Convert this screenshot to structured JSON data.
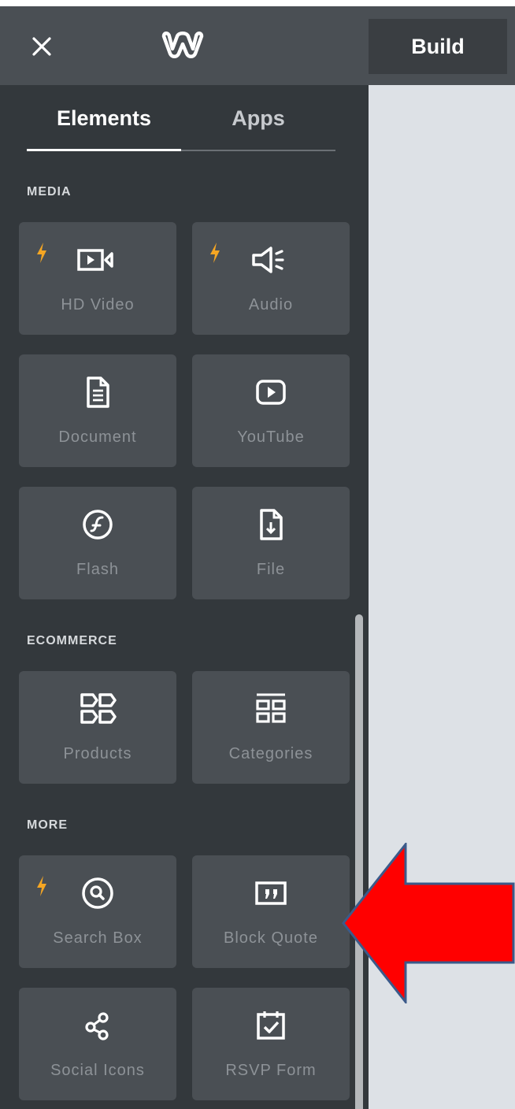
{
  "topbar": {
    "close_icon": "close-icon",
    "logo_icon": "weebly-logo-icon",
    "build_label": "Build"
  },
  "tabs": {
    "elements_label": "Elements",
    "apps_label": "Apps",
    "active": "Elements"
  },
  "sections": [
    {
      "title": "MEDIA",
      "tiles": [
        {
          "label": "HD Video",
          "icon": "video-camera-icon",
          "premium": true
        },
        {
          "label": "Audio",
          "icon": "speaker-icon",
          "premium": true
        },
        {
          "label": "Document",
          "icon": "document-icon",
          "premium": false
        },
        {
          "label": "YouTube",
          "icon": "youtube-play-icon",
          "premium": false
        },
        {
          "label": "Flash",
          "icon": "flash-icon",
          "premium": false
        },
        {
          "label": "File",
          "icon": "file-download-icon",
          "premium": false
        }
      ]
    },
    {
      "title": "ECOMMERCE",
      "tiles": [
        {
          "label": "Products",
          "icon": "products-icon",
          "premium": false
        },
        {
          "label": "Categories",
          "icon": "categories-icon",
          "premium": false
        }
      ]
    },
    {
      "title": "MORE",
      "tiles": [
        {
          "label": "Search Box",
          "icon": "search-icon",
          "premium": true
        },
        {
          "label": "Block Quote",
          "icon": "quote-icon",
          "premium": false
        },
        {
          "label": "Social Icons",
          "icon": "share-icon",
          "premium": false
        },
        {
          "label": "RSVP Form",
          "icon": "calendar-check-icon",
          "premium": false
        }
      ]
    }
  ],
  "colors": {
    "sidebar_bg": "#33383c",
    "tile_bg": "#4a4f54",
    "topbar_bg": "#4a4f54",
    "canvas_bg": "#dde1e6",
    "bolt": "#f5a623",
    "annotation_arrow": "#ff0000"
  }
}
